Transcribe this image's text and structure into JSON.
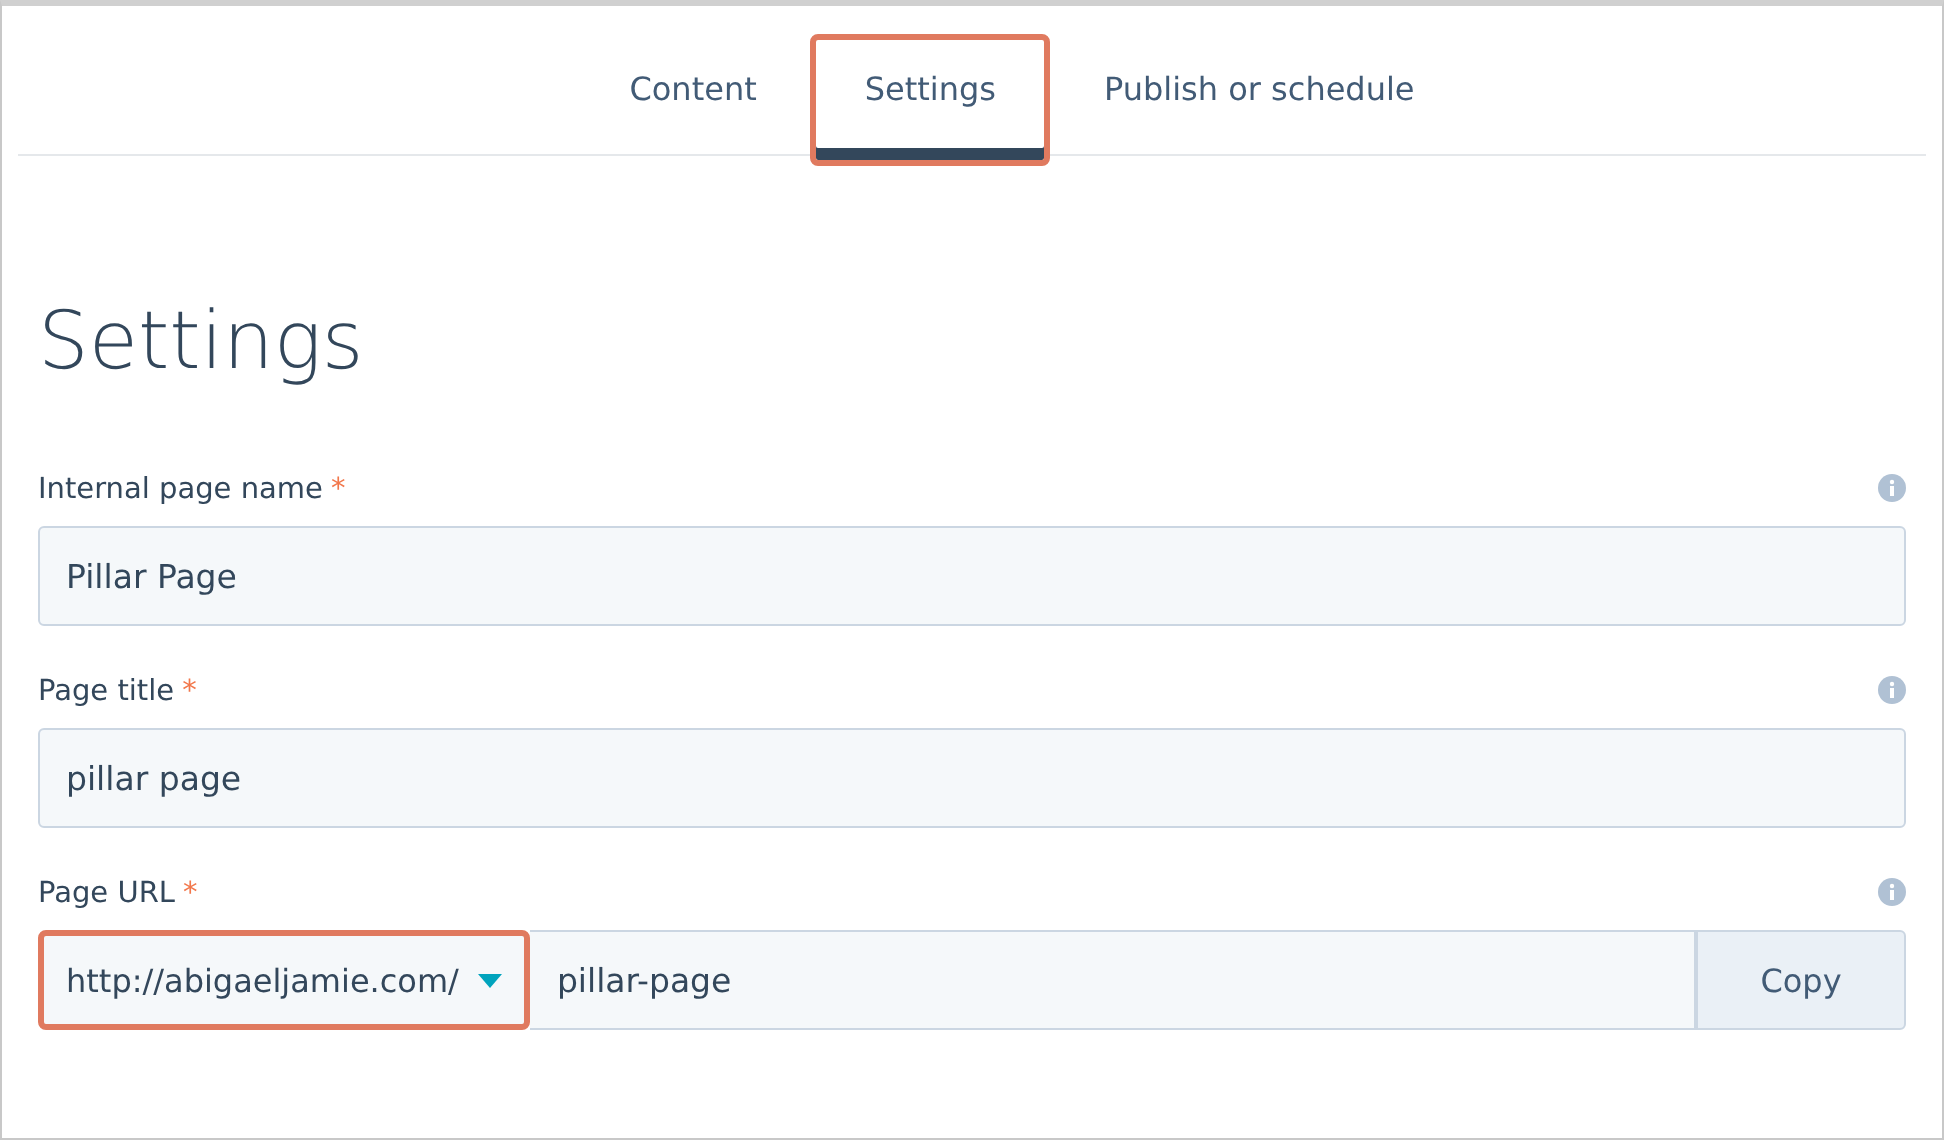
{
  "tabs": [
    {
      "label": "Content",
      "selected": false,
      "highlighted": false
    },
    {
      "label": "Settings",
      "selected": true,
      "highlighted": true
    },
    {
      "label": "Publish or schedule",
      "selected": false,
      "highlighted": false
    }
  ],
  "heading": "Settings",
  "fields": [
    {
      "kind": "text",
      "label": "Internal page name",
      "required_mark": "*",
      "value": "Pillar Page"
    },
    {
      "kind": "text",
      "label": "Page title",
      "required_mark": "*",
      "value": "pillar page"
    },
    {
      "kind": "url",
      "label": "Page URL",
      "required_mark": "*",
      "domain": "http://abigaeljamie.com/",
      "domain_highlighted": true,
      "value": "pillar-page",
      "button": "Copy"
    }
  ]
}
